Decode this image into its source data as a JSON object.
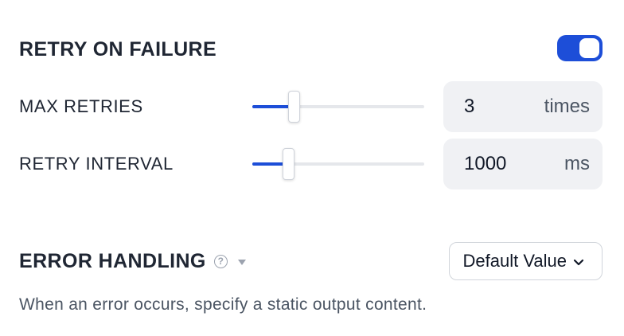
{
  "retry": {
    "title": "RETRY ON FAILURE",
    "enabled": true,
    "accent_color": "#1d4ed8",
    "max_retries": {
      "label": "MAX RETRIES",
      "value": "3",
      "unit": "times",
      "slider_fraction": 0.24
    },
    "retry_interval": {
      "label": "RETRY INTERVAL",
      "value": "1000",
      "unit": "ms",
      "slider_fraction": 0.21
    }
  },
  "error_handling": {
    "title": "ERROR HANDLING",
    "help_icon": "question-circle-icon",
    "dropdown_icon": "caret-down-icon",
    "selected_option": "Default Value",
    "description": "When an error occurs, specify a static output content."
  }
}
